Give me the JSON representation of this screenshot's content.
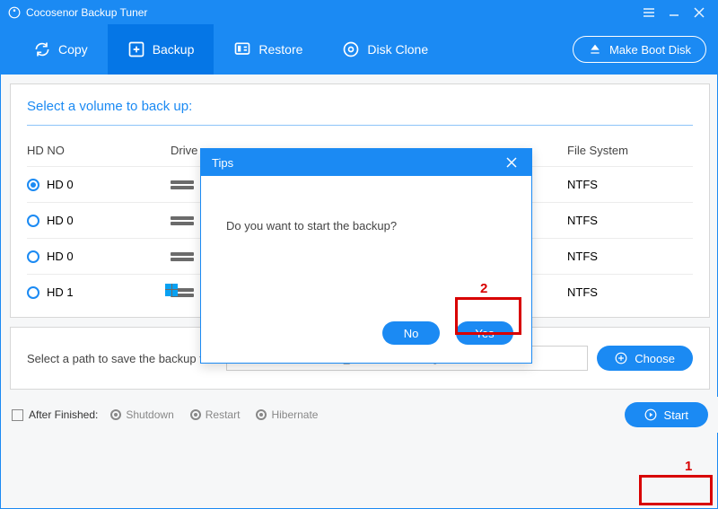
{
  "window": {
    "title": "Cocosenor Backup Tuner"
  },
  "toolbar": {
    "items": [
      {
        "label": "Copy",
        "icon": "refresh-icon",
        "active": false
      },
      {
        "label": "Backup",
        "icon": "plus-box-icon",
        "active": true
      },
      {
        "label": "Restore",
        "icon": "restore-icon",
        "active": false
      },
      {
        "label": "Disk Clone",
        "icon": "disk-clone-icon",
        "active": false
      }
    ],
    "make_boot_disk": "Make Boot Disk"
  },
  "volume_panel": {
    "title": "Select a volume to back up:",
    "columns": [
      "HD NO",
      "Drive",
      "",
      "File System"
    ],
    "rows": [
      {
        "hd": "HD 0",
        "selected": true,
        "win": false,
        "fs": "NTFS"
      },
      {
        "hd": "HD 0",
        "selected": false,
        "win": false,
        "fs": "NTFS"
      },
      {
        "hd": "HD 0",
        "selected": false,
        "win": false,
        "fs": "NTFS"
      },
      {
        "hd": "HD 1",
        "selected": false,
        "win": true,
        "fs": "NTFS"
      }
    ]
  },
  "path_panel": {
    "label": "Select a path to save the backup file:",
    "value": "E:/New folder/FileBack_202432891428.icg",
    "choose": "Choose"
  },
  "bottom": {
    "after_finished_label": "After Finished:",
    "options": [
      "Shutdown",
      "Restart",
      "Hibernate"
    ],
    "start": "Start"
  },
  "dialog": {
    "title": "Tips",
    "message": "Do you want to start the backup?",
    "no": "No",
    "yes": "Yes"
  },
  "annotations": {
    "one": "1",
    "two": "2"
  }
}
